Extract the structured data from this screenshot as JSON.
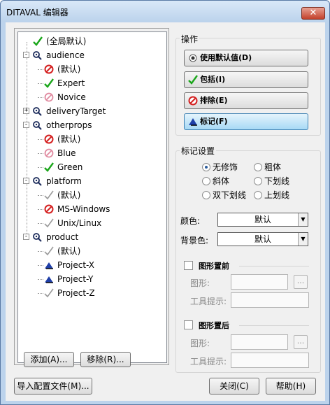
{
  "window": {
    "title": "DITAVAL 编辑器",
    "close_label": "✕"
  },
  "tree": {
    "rows": [
      {
        "label": "(全局默认)",
        "icon": "check"
      },
      {
        "label": "audience",
        "icon": "attribute"
      },
      {
        "label": "(默认)",
        "icon": "exclude"
      },
      {
        "label": "Expert",
        "icon": "check"
      },
      {
        "label": "Novice",
        "icon": "exclude-faded"
      },
      {
        "label": "deliveryTarget",
        "icon": "attribute"
      },
      {
        "label": "otherprops",
        "icon": "attribute"
      },
      {
        "label": "(默认)",
        "icon": "exclude"
      },
      {
        "label": "Blue",
        "icon": "exclude-faded"
      },
      {
        "label": "Green",
        "icon": "check"
      },
      {
        "label": "platform",
        "icon": "attribute"
      },
      {
        "label": "(默认)",
        "icon": "check-faded"
      },
      {
        "label": "MS-Windows",
        "icon": "exclude"
      },
      {
        "label": "Unix/Linux",
        "icon": "check-faded"
      },
      {
        "label": "product",
        "icon": "attribute"
      },
      {
        "label": "(默认)",
        "icon": "check-faded"
      },
      {
        "label": "Project-X",
        "icon": "flag"
      },
      {
        "label": "Project-Y",
        "icon": "flag"
      },
      {
        "label": "Project-Z",
        "icon": "check-faded"
      }
    ]
  },
  "tree_buttons": {
    "add": "添加(A)...",
    "remove": "移除(R)..."
  },
  "actions": {
    "title": "操作",
    "use_default": "使用默认值(D)",
    "include": "包括(I)",
    "exclude": "排除(E)",
    "flag": "标记(F)"
  },
  "flag_settings": {
    "title": "标记设置",
    "radios": [
      "无修饰",
      "粗体",
      "斜体",
      "下划线",
      "双下划线",
      "上划线"
    ],
    "color_label": "颜色:",
    "color_value": "默认",
    "bg_label": "背景色:",
    "bg_value": "默认",
    "image_before": {
      "label": "图形置前",
      "image_label": "图形:",
      "tooltip_label": "工具提示:",
      "browse": "..."
    },
    "image_after": {
      "label": "图形置后",
      "image_label": "图形:",
      "tooltip_label": "工具提示:",
      "browse": "..."
    }
  },
  "footer": {
    "import": "导入配置文件(M)...",
    "close": "关闭(C)",
    "help": "帮助(H)"
  },
  "colors": {
    "check": "#1aa61a",
    "exclude": "#d42020",
    "flag": "#1f3fa8",
    "accent": "#3c7fb1"
  }
}
